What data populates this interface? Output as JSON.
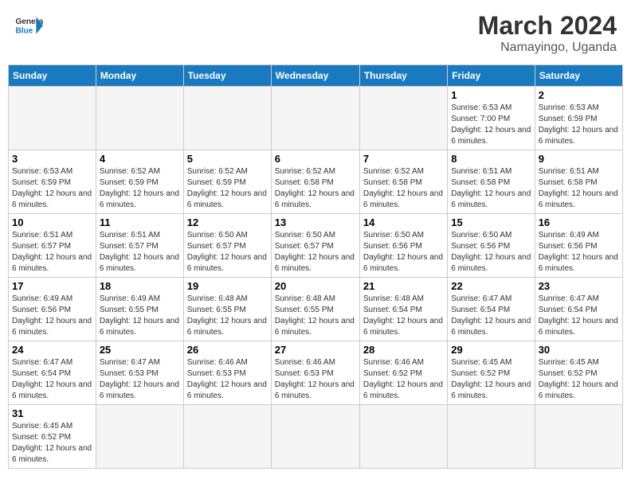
{
  "header": {
    "logo_general": "General",
    "logo_blue": "Blue",
    "month_title": "March 2024",
    "location": "Namayingo, Uganda"
  },
  "weekdays": [
    "Sunday",
    "Monday",
    "Tuesday",
    "Wednesday",
    "Thursday",
    "Friday",
    "Saturday"
  ],
  "weeks": [
    [
      {
        "day": "",
        "detail": ""
      },
      {
        "day": "",
        "detail": ""
      },
      {
        "day": "",
        "detail": ""
      },
      {
        "day": "",
        "detail": ""
      },
      {
        "day": "",
        "detail": ""
      },
      {
        "day": "1",
        "detail": "Sunrise: 6:53 AM\nSunset: 7:00 PM\nDaylight: 12 hours and 6 minutes."
      },
      {
        "day": "2",
        "detail": "Sunrise: 6:53 AM\nSunset: 6:59 PM\nDaylight: 12 hours and 6 minutes."
      }
    ],
    [
      {
        "day": "3",
        "detail": "Sunrise: 6:53 AM\nSunset: 6:59 PM\nDaylight: 12 hours and 6 minutes."
      },
      {
        "day": "4",
        "detail": "Sunrise: 6:52 AM\nSunset: 6:59 PM\nDaylight: 12 hours and 6 minutes."
      },
      {
        "day": "5",
        "detail": "Sunrise: 6:52 AM\nSunset: 6:59 PM\nDaylight: 12 hours and 6 minutes."
      },
      {
        "day": "6",
        "detail": "Sunrise: 6:52 AM\nSunset: 6:58 PM\nDaylight: 12 hours and 6 minutes."
      },
      {
        "day": "7",
        "detail": "Sunrise: 6:52 AM\nSunset: 6:58 PM\nDaylight: 12 hours and 6 minutes."
      },
      {
        "day": "8",
        "detail": "Sunrise: 6:51 AM\nSunset: 6:58 PM\nDaylight: 12 hours and 6 minutes."
      },
      {
        "day": "9",
        "detail": "Sunrise: 6:51 AM\nSunset: 6:58 PM\nDaylight: 12 hours and 6 minutes."
      }
    ],
    [
      {
        "day": "10",
        "detail": "Sunrise: 6:51 AM\nSunset: 6:57 PM\nDaylight: 12 hours and 6 minutes."
      },
      {
        "day": "11",
        "detail": "Sunrise: 6:51 AM\nSunset: 6:57 PM\nDaylight: 12 hours and 6 minutes."
      },
      {
        "day": "12",
        "detail": "Sunrise: 6:50 AM\nSunset: 6:57 PM\nDaylight: 12 hours and 6 minutes."
      },
      {
        "day": "13",
        "detail": "Sunrise: 6:50 AM\nSunset: 6:57 PM\nDaylight: 12 hours and 6 minutes."
      },
      {
        "day": "14",
        "detail": "Sunrise: 6:50 AM\nSunset: 6:56 PM\nDaylight: 12 hours and 6 minutes."
      },
      {
        "day": "15",
        "detail": "Sunrise: 6:50 AM\nSunset: 6:56 PM\nDaylight: 12 hours and 6 minutes."
      },
      {
        "day": "16",
        "detail": "Sunrise: 6:49 AM\nSunset: 6:56 PM\nDaylight: 12 hours and 6 minutes."
      }
    ],
    [
      {
        "day": "17",
        "detail": "Sunrise: 6:49 AM\nSunset: 6:56 PM\nDaylight: 12 hours and 6 minutes."
      },
      {
        "day": "18",
        "detail": "Sunrise: 6:49 AM\nSunset: 6:55 PM\nDaylight: 12 hours and 6 minutes."
      },
      {
        "day": "19",
        "detail": "Sunrise: 6:48 AM\nSunset: 6:55 PM\nDaylight: 12 hours and 6 minutes."
      },
      {
        "day": "20",
        "detail": "Sunrise: 6:48 AM\nSunset: 6:55 PM\nDaylight: 12 hours and 6 minutes."
      },
      {
        "day": "21",
        "detail": "Sunrise: 6:48 AM\nSunset: 6:54 PM\nDaylight: 12 hours and 6 minutes."
      },
      {
        "day": "22",
        "detail": "Sunrise: 6:47 AM\nSunset: 6:54 PM\nDaylight: 12 hours and 6 minutes."
      },
      {
        "day": "23",
        "detail": "Sunrise: 6:47 AM\nSunset: 6:54 PM\nDaylight: 12 hours and 6 minutes."
      }
    ],
    [
      {
        "day": "24",
        "detail": "Sunrise: 6:47 AM\nSunset: 6:54 PM\nDaylight: 12 hours and 6 minutes."
      },
      {
        "day": "25",
        "detail": "Sunrise: 6:47 AM\nSunset: 6:53 PM\nDaylight: 12 hours and 6 minutes."
      },
      {
        "day": "26",
        "detail": "Sunrise: 6:46 AM\nSunset: 6:53 PM\nDaylight: 12 hours and 6 minutes."
      },
      {
        "day": "27",
        "detail": "Sunrise: 6:46 AM\nSunset: 6:53 PM\nDaylight: 12 hours and 6 minutes."
      },
      {
        "day": "28",
        "detail": "Sunrise: 6:46 AM\nSunset: 6:52 PM\nDaylight: 12 hours and 6 minutes."
      },
      {
        "day": "29",
        "detail": "Sunrise: 6:45 AM\nSunset: 6:52 PM\nDaylight: 12 hours and 6 minutes."
      },
      {
        "day": "30",
        "detail": "Sunrise: 6:45 AM\nSunset: 6:52 PM\nDaylight: 12 hours and 6 minutes."
      }
    ],
    [
      {
        "day": "31",
        "detail": "Sunrise: 6:45 AM\nSunset: 6:52 PM\nDaylight: 12 hours and 6 minutes."
      },
      {
        "day": "",
        "detail": ""
      },
      {
        "day": "",
        "detail": ""
      },
      {
        "day": "",
        "detail": ""
      },
      {
        "day": "",
        "detail": ""
      },
      {
        "day": "",
        "detail": ""
      },
      {
        "day": "",
        "detail": ""
      }
    ]
  ]
}
